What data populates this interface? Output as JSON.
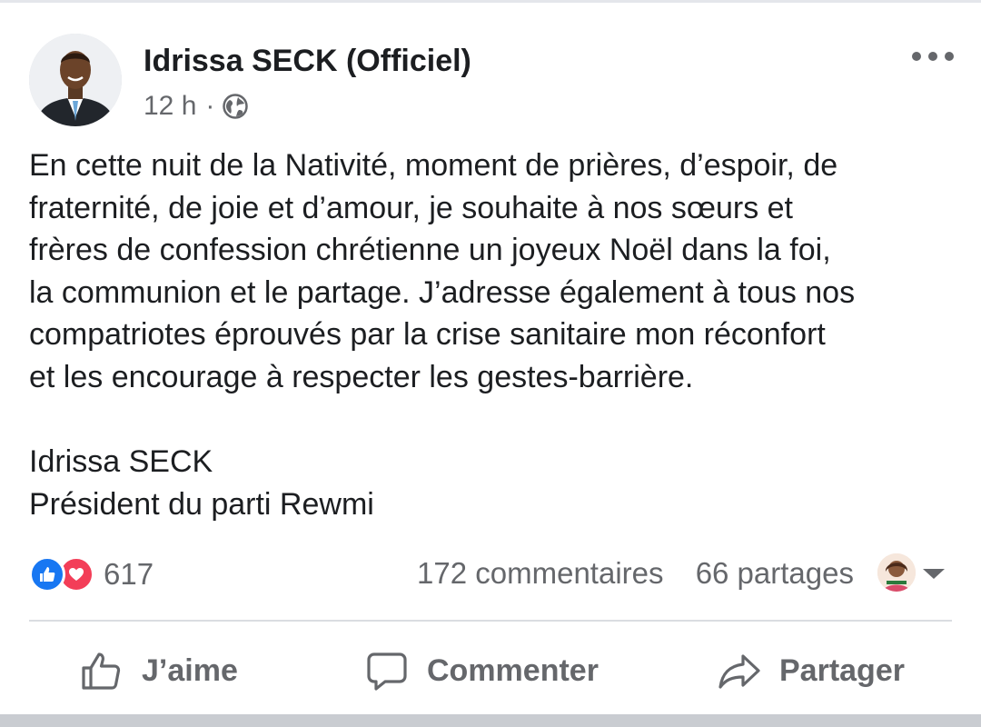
{
  "post": {
    "author": "Idrissa SECK (Officiel)",
    "time": "12 h",
    "separator": "·",
    "audience_icon": "globe-icon",
    "more_icon": "more-options-icon",
    "body_lines": [
      "En cette nuit de la Nativité, moment de prières, d’espoir, de",
      "fraternité, de joie et d’amour, je souhaite à nos sœurs et",
      "frères de confession chrétienne un joyeux Noël dans la foi,",
      "la communion et le partage. J’adresse également à tous nos",
      "compatriotes éprouvés par la crise sanitaire mon réconfort",
      "et les encourage à respecter les gestes-barrière."
    ],
    "signature": {
      "name": "Idrissa SECK",
      "role": "Président du parti Rewmi"
    }
  },
  "engagement": {
    "reaction_icons": [
      "like-reaction-icon",
      "love-reaction-icon"
    ],
    "reactions_count": "617",
    "comments": "172 commentaires",
    "shares": "66 partages"
  },
  "actions": {
    "like_label": "J’aime",
    "comment_label": "Commenter",
    "share_label": "Partager"
  },
  "colors": {
    "like_blue": "#1877f2",
    "love_red": "#f33e58",
    "secondary_text": "#65676b",
    "primary_text": "#1c1e21"
  }
}
